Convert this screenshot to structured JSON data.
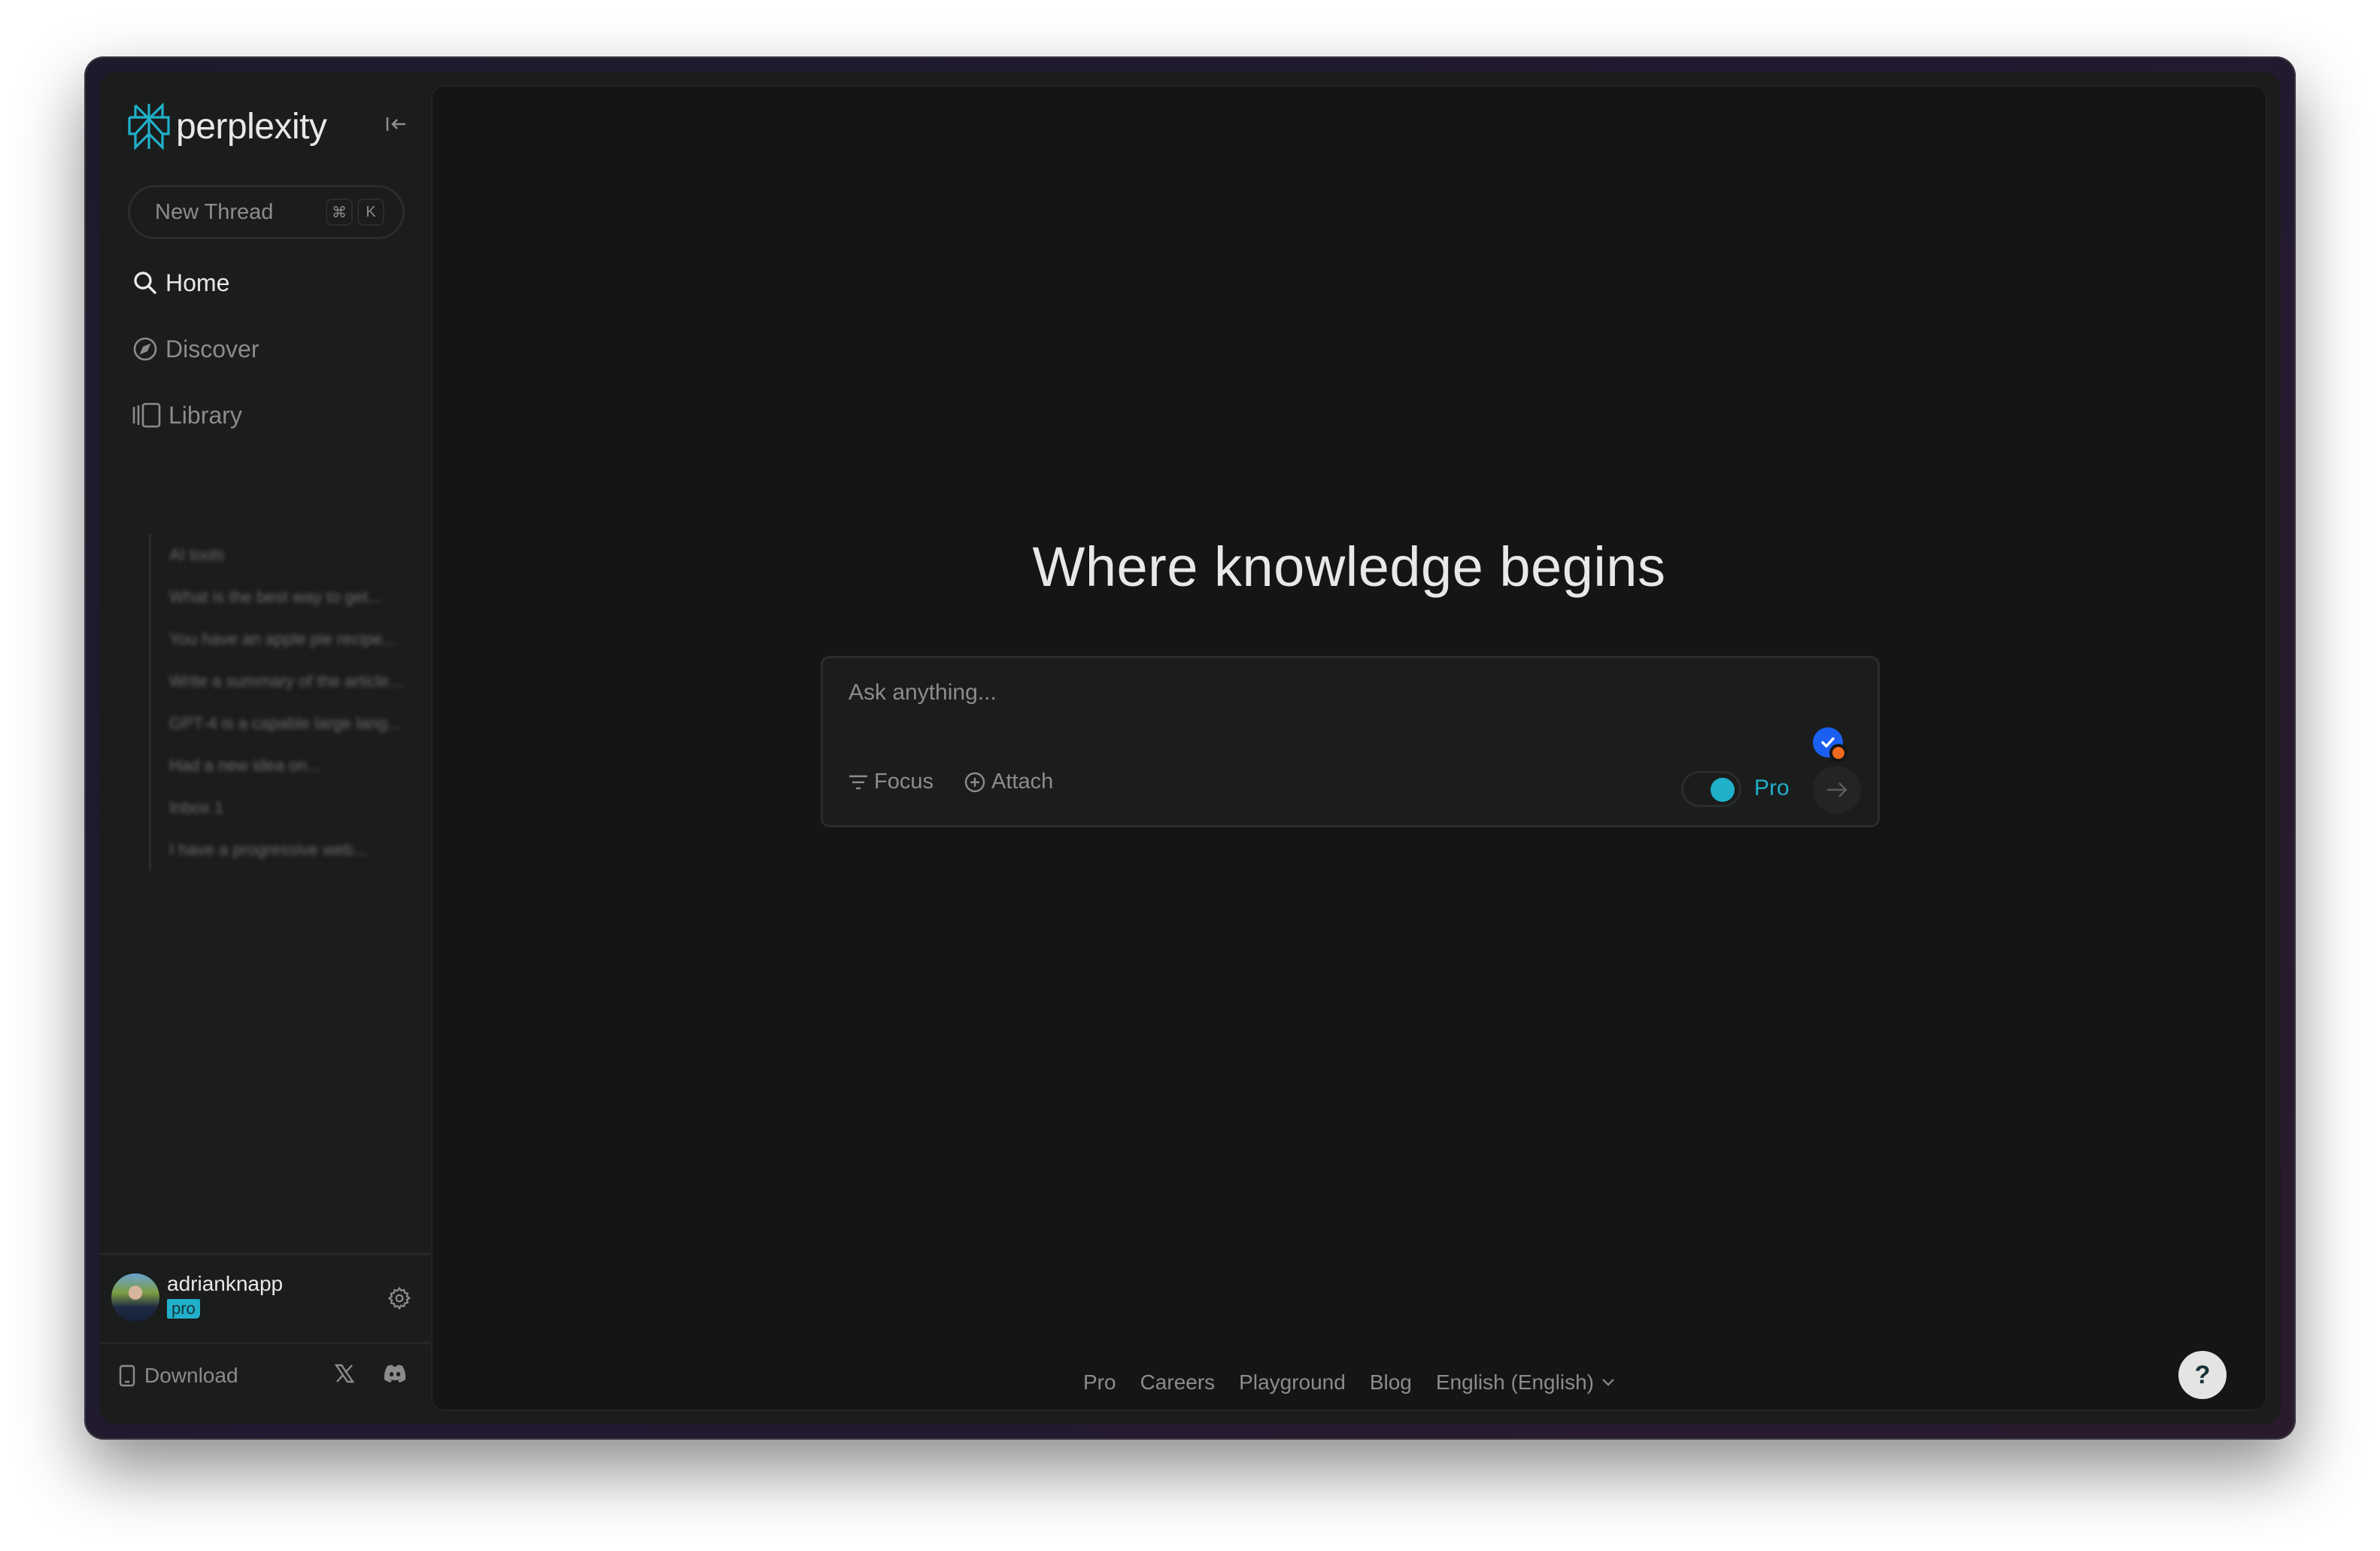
{
  "app": {
    "brand": "perplexity",
    "accent_color": "#20b0c9"
  },
  "sidebar": {
    "new_thread_label": "New Thread",
    "shortcut_keys": [
      "⌘",
      "K"
    ],
    "nav": [
      {
        "label": "Home",
        "icon": "search-icon",
        "active": true
      },
      {
        "label": "Discover",
        "icon": "compass-icon",
        "active": false
      },
      {
        "label": "Library",
        "icon": "library-icon",
        "active": false
      }
    ],
    "library_items": [
      "AI tools",
      "What is the best way to get...",
      "You have an apple pie recipe...",
      "Write a summary of the article...",
      "GPT-4 is a capable large lang...",
      "Had a new idea on...",
      "Inbox 1",
      "I have a progressive web..."
    ],
    "user": {
      "username": "adrianknapp",
      "badge": "pro"
    },
    "download_label": "Download"
  },
  "main": {
    "headline": "Where knowledge begins",
    "ask": {
      "placeholder": "Ask anything...",
      "value": "",
      "focus_label": "Focus",
      "attach_label": "Attach",
      "pro_label": "Pro",
      "pro_enabled": true
    },
    "footer_links": [
      "Pro",
      "Careers",
      "Playground",
      "Blog"
    ],
    "language": "English (English)",
    "help_label": "?"
  }
}
